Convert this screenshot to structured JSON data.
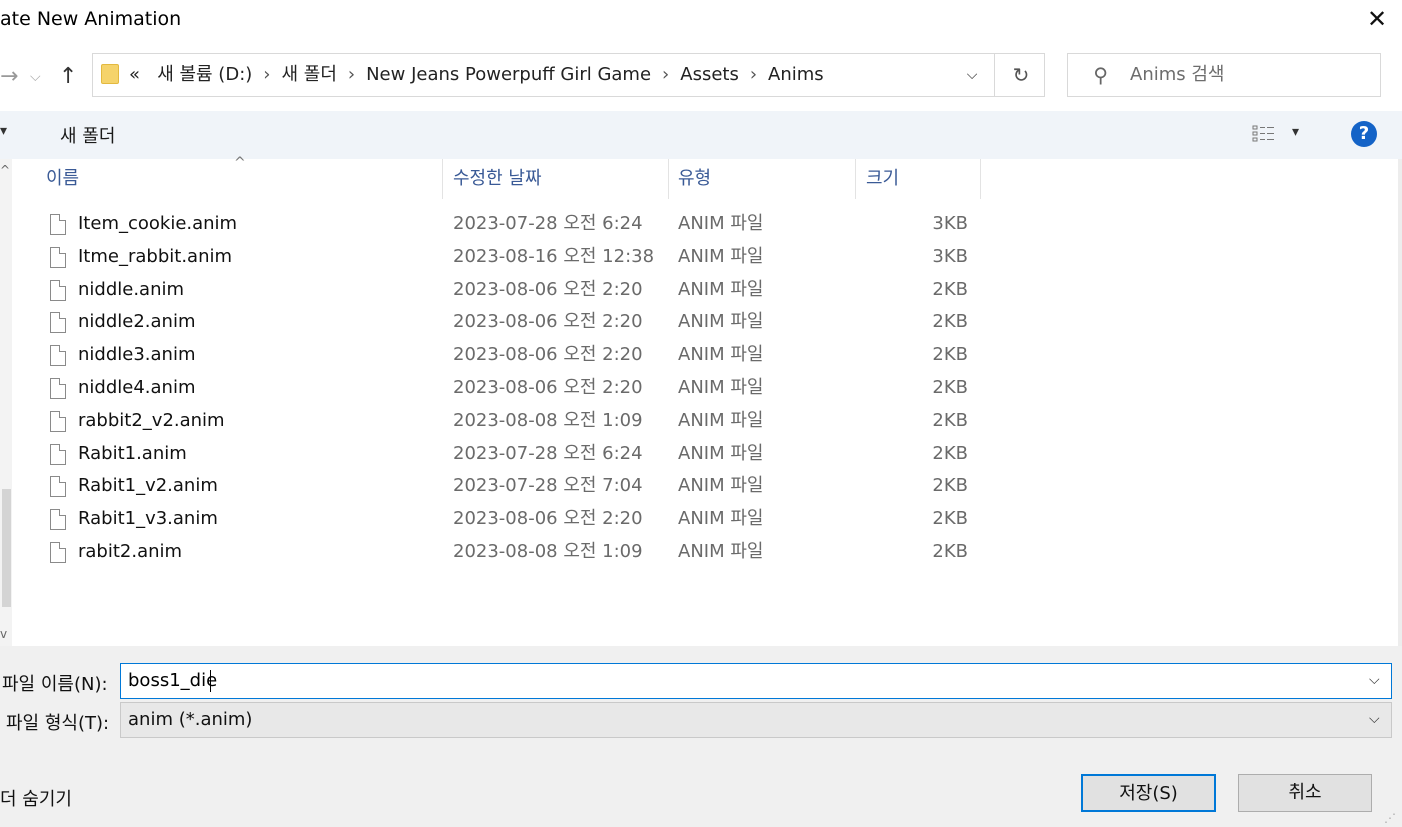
{
  "window": {
    "title": "ate New Animation",
    "close_glyph": "✕"
  },
  "nav": {
    "back": "→",
    "recent_dropdown": "⌵",
    "up": "↑"
  },
  "address": {
    "overflow": "«",
    "crumbs": [
      "새 볼륨 (D:)",
      "새 폴더",
      "New Jeans Powerpuff Girl Game",
      "Assets",
      "Anims"
    ],
    "separator": "›",
    "dropdown": "⌵",
    "refresh": "↻"
  },
  "search": {
    "placeholder": "Anims 검색",
    "icon": "search-icon"
  },
  "toolbar": {
    "new_folder": "새 폴더",
    "view_dropdown": "▾",
    "help": "?",
    "left_dropdown": "▾"
  },
  "columns": {
    "name": "이름",
    "date": "수정한 날짜",
    "type": "유형",
    "size": "크기",
    "sort_indicator": "^"
  },
  "files": [
    {
      "name": "Item_cookie.anim",
      "date": "2023-07-28 오전 6:24",
      "type": "ANIM 파일",
      "size": "3KB"
    },
    {
      "name": "Itme_rabbit.anim",
      "date": "2023-08-16 오전 12:38",
      "type": "ANIM 파일",
      "size": "3KB"
    },
    {
      "name": "niddle.anim",
      "date": "2023-08-06 오전 2:20",
      "type": "ANIM 파일",
      "size": "2KB"
    },
    {
      "name": "niddle2.anim",
      "date": "2023-08-06 오전 2:20",
      "type": "ANIM 파일",
      "size": "2KB"
    },
    {
      "name": "niddle3.anim",
      "date": "2023-08-06 오전 2:20",
      "type": "ANIM 파일",
      "size": "2KB"
    },
    {
      "name": "niddle4.anim",
      "date": "2023-08-06 오전 2:20",
      "type": "ANIM 파일",
      "size": "2KB"
    },
    {
      "name": "rabbit2_v2.anim",
      "date": "2023-08-08 오전 1:09",
      "type": "ANIM 파일",
      "size": "2KB"
    },
    {
      "name": "Rabit1.anim",
      "date": "2023-07-28 오전 6:24",
      "type": "ANIM 파일",
      "size": "2KB"
    },
    {
      "name": "Rabit1_v2.anim",
      "date": "2023-07-28 오전 7:04",
      "type": "ANIM 파일",
      "size": "2KB"
    },
    {
      "name": "Rabit1_v3.anim",
      "date": "2023-08-06 오전 2:20",
      "type": "ANIM 파일",
      "size": "2KB"
    },
    {
      "name": "rabit2.anim",
      "date": "2023-08-08 오전 1:09",
      "type": "ANIM 파일",
      "size": "2KB"
    }
  ],
  "form": {
    "filename_label": "파일 이름(N):",
    "filename_value": "boss1_die",
    "filetype_label": "파일 형식(T):",
    "filetype_value": "anim (*.anim)",
    "dropdown_glyph": "⌵"
  },
  "footer": {
    "hide_folders": "더 숨기기",
    "save": "저장(S)",
    "cancel": "취소"
  },
  "colors": {
    "accent": "#0078d7",
    "help": "#1463c7",
    "toolbar_bg": "#f0f4f9",
    "bottom_bg": "#f0f0f0"
  }
}
